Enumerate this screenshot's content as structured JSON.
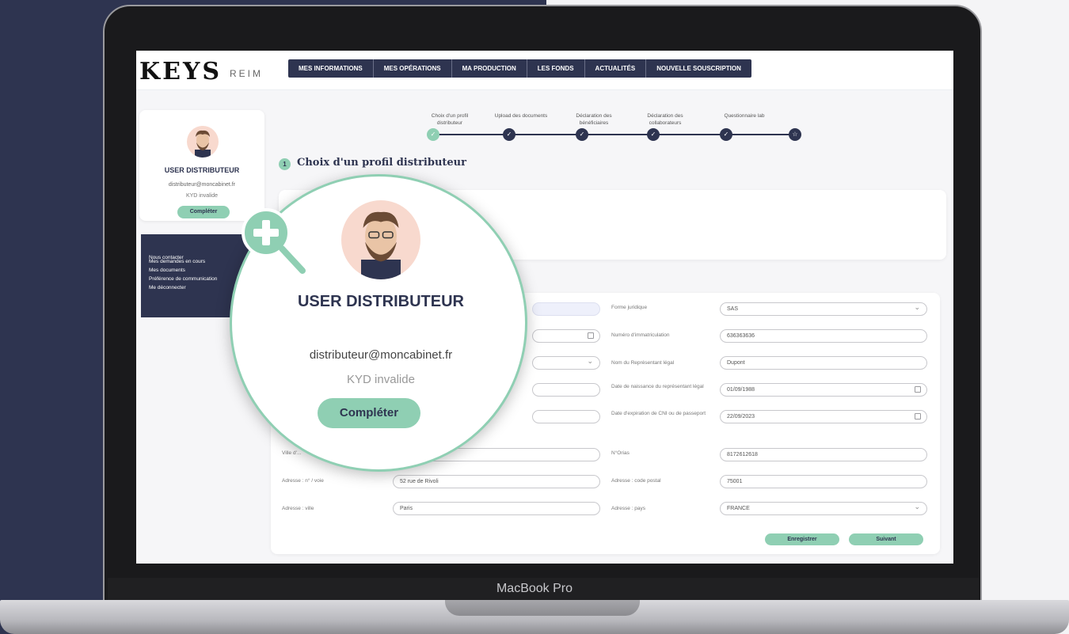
{
  "device_label": "MacBook Pro",
  "logo": {
    "brand": "KEYS",
    "sub": "REIM"
  },
  "nav": {
    "items": [
      "MES INFORMATIONS",
      "MES OPÉRATIONS",
      "MA PRODUCTION",
      "LES FONDS",
      "ACTUALITÉS",
      "NOUVELLE SOUSCRIPTION"
    ]
  },
  "profile": {
    "name": "USER DISTRIBUTEUR",
    "email": "distributeur@moncabinet.fr",
    "kyd_status": "KYD invalide",
    "complete_button": "Compléter",
    "menu": [
      "Nous contacter",
      "Mes demandes en cours",
      "Mes documents",
      "Préférence de communication",
      "Me déconnecter"
    ]
  },
  "stepper": {
    "steps": [
      {
        "label": "Choix d'un profil distributeur",
        "state": "done"
      },
      {
        "label": "Upload des documents",
        "state": "done"
      },
      {
        "label": "Déclaration des bénéficiaires",
        "state": "done"
      },
      {
        "label": "Déclaration des collaborateurs",
        "state": "done"
      },
      {
        "label": "Questionnaire lab",
        "state": "todo"
      }
    ]
  },
  "section": {
    "number": "1",
    "title": "Choix d'un profil distributeur"
  },
  "form": {
    "left": [
      {
        "label": "Ville d'...",
        "value": ""
      },
      {
        "label": "Adresse : n° / voie",
        "value": "52 rue de Rivoli"
      },
      {
        "label": "Adresse : ville",
        "value": "Paris"
      }
    ],
    "right": [
      {
        "label": "Forme juridique",
        "value": "SAS",
        "type": "select"
      },
      {
        "label": "Numéro d'immatriculation",
        "value": "636363636",
        "type": "text"
      },
      {
        "label": "Nom du Représentant légal",
        "value": "Dupont",
        "type": "text"
      },
      {
        "label": "Date de naissance du représentant légal",
        "value": "01/09/1988",
        "type": "date"
      },
      {
        "label": "Date d'expiration de CNI ou de passeport",
        "value": "22/09/2023",
        "type": "date"
      },
      {
        "label": "N°Orias",
        "value": "8172612618",
        "type": "text"
      },
      {
        "label": "Adresse : code postal",
        "value": "75001",
        "type": "text"
      },
      {
        "label": "Adresse : pays",
        "value": "FRANCE",
        "type": "select"
      }
    ],
    "save_label": "Enregistrer",
    "next_label": "Suivant"
  },
  "colors": {
    "navy": "#2e3450",
    "mint": "#8fcfb3"
  },
  "icons": {
    "zoom": "zoom-in-icon"
  }
}
